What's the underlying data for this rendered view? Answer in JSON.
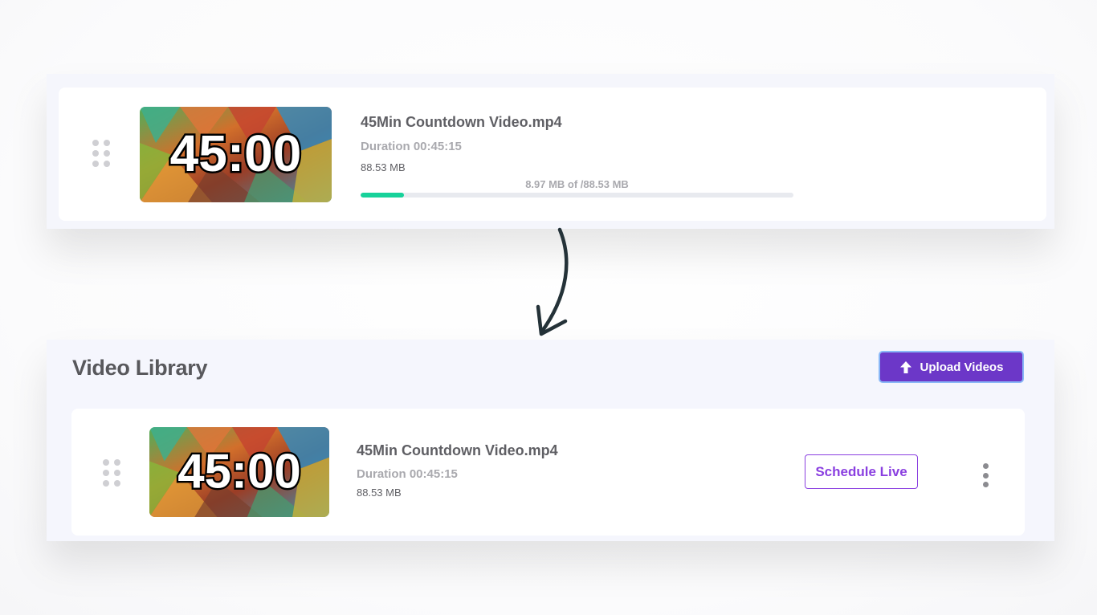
{
  "uploading": {
    "file_name": "45Min Countdown Video.mp4",
    "duration": "Duration 00:45:15",
    "size": "88.53 MB",
    "progress_text": "8.97 MB of /88.53 MB",
    "progress_fraction": 0.101,
    "thumbnail_text": "45:00"
  },
  "library": {
    "title": "Video Library",
    "upload_button_label": "Upload Videos",
    "items": [
      {
        "file_name": "45Min Countdown Video.mp4",
        "duration": "Duration 00:45:15",
        "size": "88.53 MB",
        "thumbnail_text": "45:00",
        "schedule_label": "Schedule Live"
      }
    ]
  },
  "colors": {
    "accent_purple": "#6c37c8",
    "schedule_purple": "#8a3fe0",
    "progress_green": "#17d29a",
    "panel_bg": "#f5f6fc"
  },
  "icons": {
    "drag": "drag-handle-icon",
    "upload": "arrow-up-icon",
    "more": "more-vertical-icon",
    "flow": "curved-arrow-down-icon"
  }
}
